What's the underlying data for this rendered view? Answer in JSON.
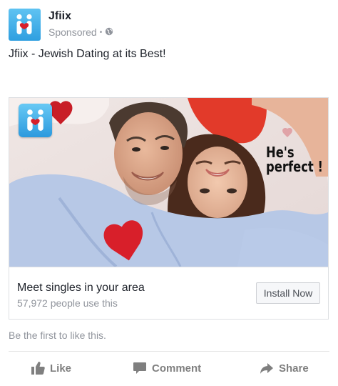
{
  "post": {
    "page_name": "Jfiix",
    "sponsored_label": "Sponsored",
    "globe_icon": "globe-icon",
    "caption": "Jfiix - Jewish Dating at its Best!"
  },
  "ad": {
    "overlay_text": "He's perfect !",
    "cta_title": "Meet singles in your area",
    "cta_subtitle": "57,972 people use this",
    "install_label": "Install Now"
  },
  "engagement": {
    "likes_text": "Be the first to like this."
  },
  "actions": [
    {
      "label": "Like",
      "icon": "thumbs-up-icon"
    },
    {
      "label": "Comment",
      "icon": "comment-icon"
    },
    {
      "label": "Share",
      "icon": "share-arrow-icon"
    }
  ],
  "colors": {
    "brand_blue": "#2f9fe0",
    "text_primary": "#1d2129",
    "text_secondary": "#90949c",
    "heart_red": "#d81f2a"
  }
}
